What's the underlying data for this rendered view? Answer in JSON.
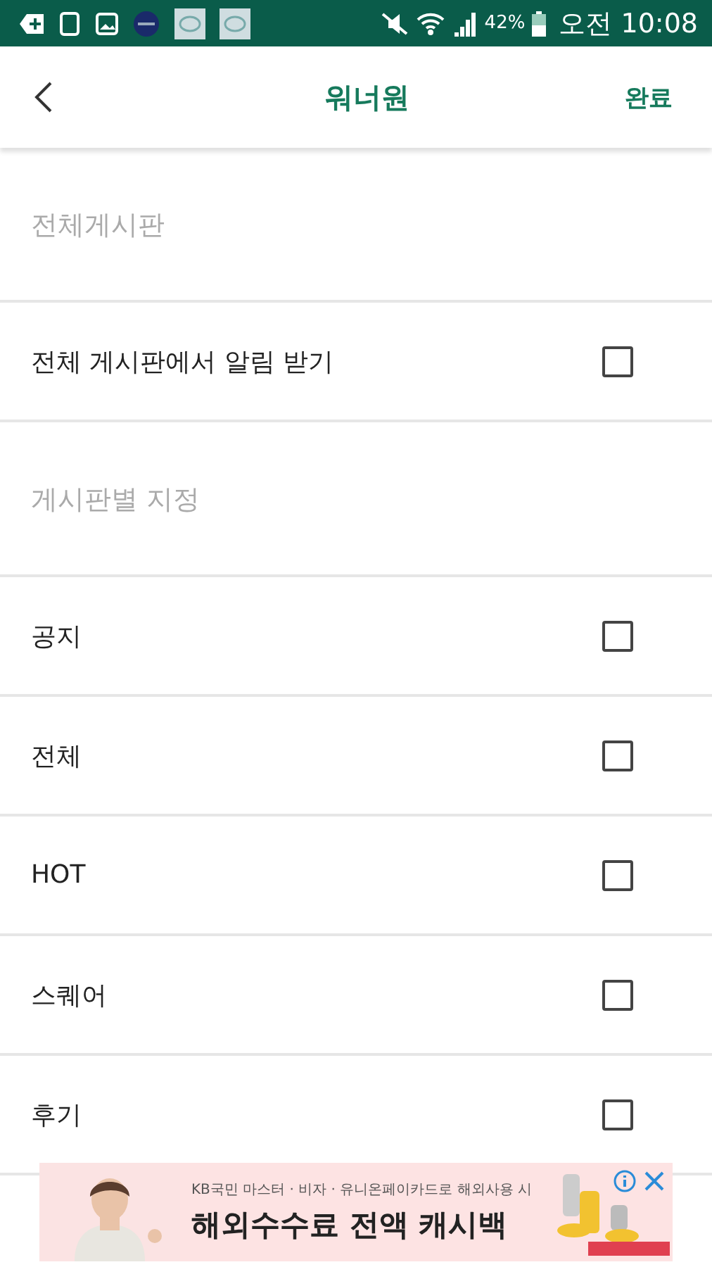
{
  "status_bar": {
    "battery": "42%",
    "time": "오전 10:08"
  },
  "header": {
    "title": "워너원",
    "done": "완료"
  },
  "sections": [
    {
      "title": "전체게시판",
      "items": [
        {
          "label": "전체 게시판에서 알림 받기",
          "checked": false
        }
      ]
    },
    {
      "title": "게시판별 지정",
      "items": [
        {
          "label": "공지",
          "checked": false
        },
        {
          "label": "전체",
          "checked": false
        },
        {
          "label": "HOT",
          "checked": false
        },
        {
          "label": "스퀘어",
          "checked": false
        },
        {
          "label": "후기",
          "checked": false
        }
      ]
    }
  ],
  "ad": {
    "line1": "KB국민 마스터 · 비자 · 유니온페이카드로 해외사용 시",
    "headline": "해외수수료 **전액 캐시백**"
  }
}
